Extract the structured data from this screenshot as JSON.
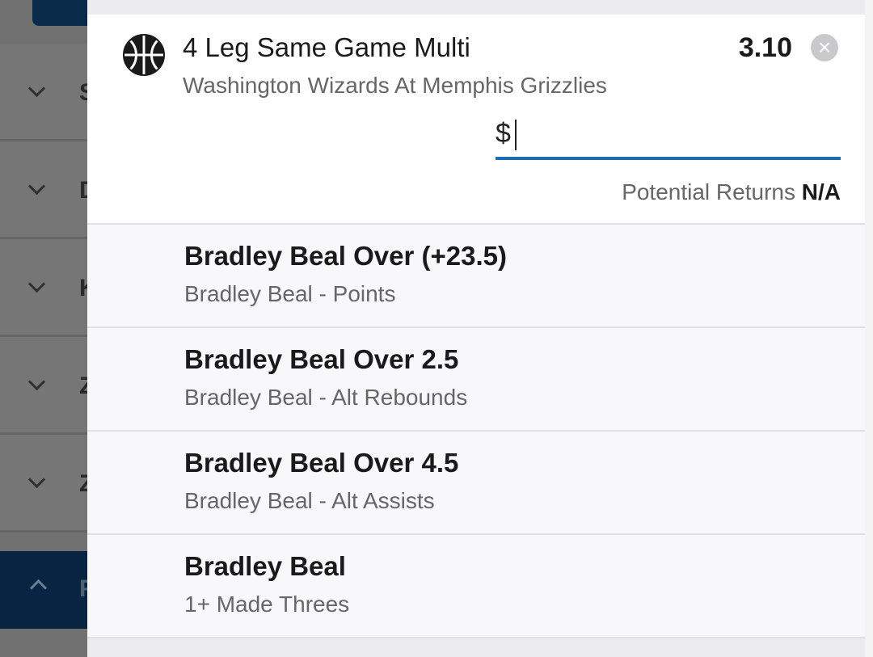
{
  "background": {
    "rows": [
      {
        "letter": "S"
      },
      {
        "letter": "D"
      },
      {
        "letter": "K"
      },
      {
        "letter": "Z"
      },
      {
        "letter": "Z"
      }
    ],
    "active_letter": "F"
  },
  "bet": {
    "icon": "basketball-icon",
    "title": "4 Leg Same Game Multi",
    "event": "Washington Wizards At Memphis Grizzlies",
    "odds": "3.10",
    "stake_symbol": "$",
    "stake_value": "",
    "potential_returns_label": "Potential Returns",
    "potential_returns_value": "N/A"
  },
  "legs": [
    {
      "selection": "Bradley Beal Over (+23.5)",
      "market": "Bradley Beal - Points"
    },
    {
      "selection": "Bradley Beal Over 2.5",
      "market": "Bradley Beal - Alt Rebounds"
    },
    {
      "selection": "Bradley Beal Over 4.5",
      "market": "Bradley Beal - Alt Assists"
    },
    {
      "selection": "Bradley Beal",
      "market": "1+ Made Threes"
    }
  ],
  "colors": {
    "accent": "#1a6fb5",
    "active_row": "#072443"
  }
}
